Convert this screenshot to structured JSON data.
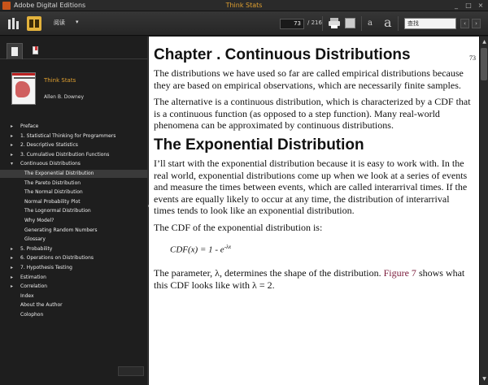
{
  "window": {
    "app_name": "Adobe Digital Editions",
    "title": "Think Stats",
    "controls": [
      "_",
      "□",
      "×"
    ]
  },
  "toolbar": {
    "menu_label": "阅读",
    "menu_arrow": "▾",
    "current_page": "73",
    "total_pages": "/ 216",
    "font_small": "a",
    "font_large": "a",
    "search_value": "查找",
    "prev": "‹",
    "next": "›"
  },
  "sidebar": {
    "book_title": "Think Stats",
    "book_author": "Allen B. Downey",
    "toc": [
      {
        "label": "Preface",
        "bullet": "▸",
        "indent": 0,
        "selected": false
      },
      {
        "label": "1. Statistical Thinking for Programmers",
        "bullet": "▸",
        "indent": 0,
        "selected": false
      },
      {
        "label": "2. Descriptive Statistics",
        "bullet": "▸",
        "indent": 0,
        "selected": false
      },
      {
        "label": "3. Cumulative Distribution Functions",
        "bullet": "▸",
        "indent": 0,
        "selected": false
      },
      {
        "label": "Continuous Distributions",
        "bullet": "▾",
        "indent": 0,
        "selected": false
      },
      {
        "label": "The Exponential Distribution",
        "bullet": "",
        "indent": 1,
        "selected": true
      },
      {
        "label": "The Pareto Distribution",
        "bullet": "",
        "indent": 1,
        "selected": false
      },
      {
        "label": "The Normal Distribution",
        "bullet": "",
        "indent": 1,
        "selected": false
      },
      {
        "label": "Normal Probability Plot",
        "bullet": "",
        "indent": 1,
        "selected": false
      },
      {
        "label": "The Lognormal Distribution",
        "bullet": "",
        "indent": 1,
        "selected": false
      },
      {
        "label": "Why Model?",
        "bullet": "",
        "indent": 1,
        "selected": false
      },
      {
        "label": "Generating Random Numbers",
        "bullet": "",
        "indent": 1,
        "selected": false
      },
      {
        "label": "Glossary",
        "bullet": "",
        "indent": 1,
        "selected": false
      },
      {
        "label": "5. Probability",
        "bullet": "▸",
        "indent": 0,
        "selected": false
      },
      {
        "label": "6. Operations on Distributions",
        "bullet": "▸",
        "indent": 0,
        "selected": false
      },
      {
        "label": "7. Hypothesis Testing",
        "bullet": "▸",
        "indent": 0,
        "selected": false
      },
      {
        "label": "Estimation",
        "bullet": "▸",
        "indent": 0,
        "selected": false
      },
      {
        "label": "Correlation",
        "bullet": "▸",
        "indent": 0,
        "selected": false
      },
      {
        "label": "Index",
        "bullet": "",
        "indent": 0,
        "selected": false
      },
      {
        "label": "About the Author",
        "bullet": "",
        "indent": 0,
        "selected": false
      },
      {
        "label": "Colophon",
        "bullet": "",
        "indent": 0,
        "selected": false
      }
    ]
  },
  "content": {
    "page_number": "73",
    "chapter_title": "Chapter . Continuous Distributions",
    "para1": "The distributions we have used so far are called empirical distributions because they are based on empirical observations, which are necessarily finite samples.",
    "para2": "The alternative is a continuous distribution, which is characterized by a CDF that is a continuous function (as opposed to a step function). Many real-world phenomena can be approximated by continuous distributions.",
    "section_title": "The Exponential Distribution",
    "para3": "I’ll start with the exponential distribution because it is easy to work with. In the real world, exponential distributions come up when we look at a series of events and measure the times between events, which are called interarrival times. If the events are equally likely to occur at any time, the distribution of interarrival times tends to look like an exponential distribution.",
    "para4": "The CDF of the exponential distribution is:",
    "formula_base": "CDF(x) = 1 - e",
    "formula_exp": "-λx",
    "para5_before": "The parameter, λ, determines the shape of the distribution. ",
    "para5_link": "Figure 7",
    "para5_after": " shows what this CDF looks like with λ = 2."
  },
  "scrollbar": {
    "up": "▲",
    "down": "▼"
  }
}
